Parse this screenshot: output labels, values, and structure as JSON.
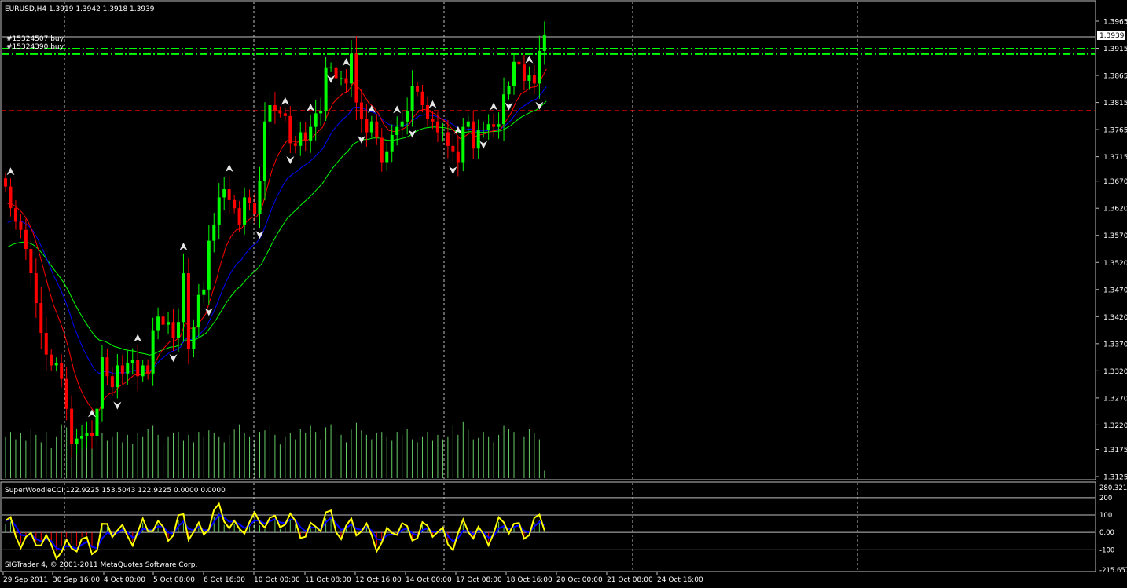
{
  "colors": {
    "background": "#000000",
    "bull": "#00ff00",
    "bear": "#ff0000",
    "frame": "#c0c0c0",
    "text": "#ffffff",
    "ma_fast": "#ff0000",
    "ma_mid": "#0000ff",
    "ma_slow": "#00ff00",
    "cci": "#0000ff",
    "turbo_cci": "#ffff00",
    "hist_bull": "#66cc66",
    "hist_bear": "#ff0000",
    "order_line": "#00ff00",
    "stop_line": "#ff0000",
    "volume": "#66cc66",
    "fractal": "#e6e6e6"
  },
  "header": {
    "symbol_label": "EURUSD,H4  1.3919 1.3942 1.3918 1.3939"
  },
  "orders": [
    {
      "label": "#15324507 buy",
      "price": 1.3915
    },
    {
      "label": "#15324390 buy",
      "price": 1.3905
    }
  ],
  "stop_level": 1.38,
  "current_price_label": "1.3939",
  "indicator": {
    "label": "SuperWoodieCCI 122.9225 153.5043 122.9225 0.0000 0.0000",
    "copyright": "SIGTrader 4, © 2001-2011 MetaQuotes Software Corp.",
    "scale_labels": [
      "280.321",
      "200",
      "100",
      "0.00",
      "-100",
      "-215.657"
    ]
  },
  "chart_data": {
    "type": "candlestick",
    "symbol": "EURUSD",
    "timeframe": "H4",
    "price_axis": {
      "ylim": [
        1.3125,
        1.3965
      ],
      "ticks": [
        "1.3965",
        "1.3915",
        "1.3865",
        "1.3815",
        "1.3765",
        "1.3715",
        "1.3670",
        "1.3620",
        "1.3570",
        "1.3520",
        "1.3470",
        "1.3420",
        "1.3370",
        "1.3320",
        "1.3270",
        "1.3220",
        "1.3175",
        "1.3125"
      ]
    },
    "x_labels": [
      "29 Sep 2011",
      "30 Sep 16:00",
      "4 Oct 00:00",
      "5 Oct 08:00",
      "6 Oct 16:00",
      "10 Oct 00:00",
      "11 Oct 08:00",
      "12 Oct 16:00",
      "14 Oct 00:00",
      "17 Oct 08:00",
      "18 Oct 16:00",
      "20 Oct 00:00",
      "21 Oct 08:00",
      "24 Oct 16:00"
    ],
    "close": [
      1.366,
      1.362,
      1.3595,
      1.358,
      1.3545,
      1.35,
      1.3445,
      1.339,
      1.335,
      1.333,
      1.3335,
      1.3305,
      1.325,
      1.3185,
      1.3195,
      1.32,
      1.3205,
      1.32,
      1.325,
      1.3345,
      1.331,
      1.329,
      1.333,
      1.3315,
      1.3335,
      1.334,
      1.331,
      1.333,
      1.3315,
      1.3395,
      1.342,
      1.3405,
      1.341,
      1.338,
      1.341,
      1.35,
      1.336,
      1.34,
      1.346,
      1.347,
      1.356,
      1.359,
      1.364,
      1.3655,
      1.3635,
      1.362,
      1.359,
      1.364,
      1.363,
      1.361,
      1.367,
      1.378,
      1.381,
      1.38,
      1.3795,
      1.379,
      1.374,
      1.3735,
      1.376,
      1.3745,
      1.377,
      1.3795,
      1.38,
      1.388,
      1.388,
      1.386,
      1.386,
      1.385,
      1.3905,
      1.3815,
      1.3785,
      1.376,
      1.378,
      1.375,
      1.3705,
      1.3725,
      1.3755,
      1.377,
      1.378,
      1.38,
      1.3845,
      1.3835,
      1.381,
      1.3785,
      1.378,
      1.376,
      1.376,
      1.3735,
      1.3725,
      1.3705,
      1.377,
      1.378,
      1.373,
      1.3765,
      1.3765,
      1.3775,
      1.377,
      1.3775,
      1.383,
      1.3845,
      1.389,
      1.3885,
      1.3855,
      1.3865,
      1.385,
      1.391,
      1.3939
    ],
    "volume": [
      0.55,
      0.62,
      0.52,
      0.6,
      0.5,
      0.65,
      0.58,
      0.48,
      0.62,
      0.4,
      0.55,
      0.72,
      0.68,
      0.6,
      0.45,
      0.5,
      0.48,
      0.7,
      0.66,
      0.6,
      0.5,
      0.55,
      0.62,
      0.48,
      0.58,
      0.46,
      0.6,
      0.55,
      0.66,
      0.7,
      0.58,
      0.45,
      0.55,
      0.6,
      0.62,
      0.5,
      0.58,
      0.48,
      0.62,
      0.55,
      0.64,
      0.6,
      0.55,
      0.48,
      0.58,
      0.65,
      0.72,
      0.6,
      0.55,
      0.5,
      0.62,
      0.64,
      0.7,
      0.58,
      0.45,
      0.55,
      0.6,
      0.52,
      0.66,
      0.6,
      0.7,
      0.62,
      0.52,
      0.68,
      0.72,
      0.62,
      0.58,
      0.48,
      0.65,
      0.74,
      0.64,
      0.58,
      0.52,
      0.6,
      0.62,
      0.55,
      0.5,
      0.62,
      0.58,
      0.66,
      0.52,
      0.48,
      0.55,
      0.62,
      0.5,
      0.58,
      0.52,
      0.55,
      0.7,
      0.58,
      0.76,
      0.65,
      0.52,
      0.54,
      0.62,
      0.55,
      0.48,
      0.58,
      0.7,
      0.66,
      0.62,
      0.6,
      0.55,
      0.66,
      0.6,
      0.52,
      0.1
    ],
    "cci_ylim": [
      -215.657,
      280.321
    ],
    "fractals_up_idx": [
      1,
      17,
      26,
      35,
      44,
      55,
      60,
      67,
      72,
      77,
      84,
      89,
      96,
      103
    ],
    "fractals_down_idx": [
      22,
      33,
      40,
      50,
      56,
      64,
      70,
      80,
      88,
      94,
      99,
      105
    ]
  }
}
